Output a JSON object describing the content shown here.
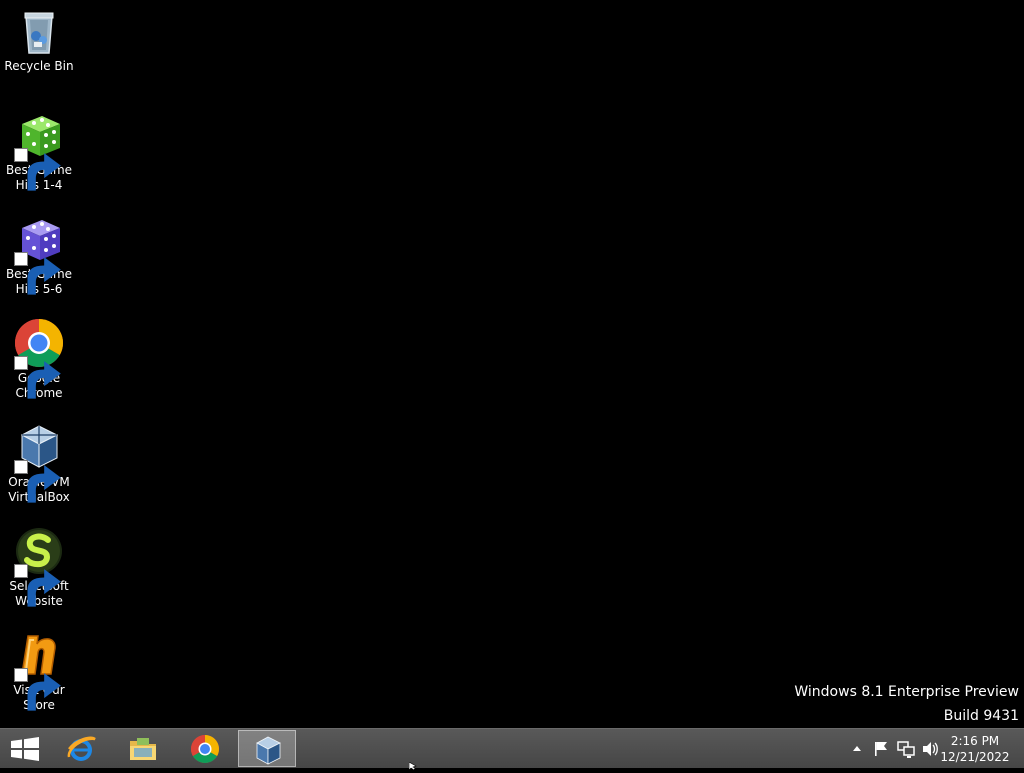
{
  "desktop": {
    "icons": [
      {
        "label": "Recycle Bin",
        "icon": "recycle-bin-icon"
      },
      {
        "label": "Best Game Hits 1-4",
        "line1": "Best Game",
        "line2": "Hits 1-4",
        "icon": "green-dice-icon"
      },
      {
        "label": "Best Game Hits 5-6",
        "line1": "Best Game",
        "line2": "Hits 5-6",
        "icon": "purple-dice-icon"
      },
      {
        "label": "Google Chrome",
        "line1": "Google",
        "line2": "Chrome",
        "icon": "chrome-icon"
      },
      {
        "label": "Oracle VM VirtualBox",
        "line1": "Oracle VM",
        "line2": "VirtualBox",
        "icon": "virtualbox-icon"
      },
      {
        "label": "Selectsoft Website",
        "line1": "Selectsoft",
        "line2": "Website",
        "icon": "selectsoft-icon"
      },
      {
        "label": "Visit Our Store",
        "line1": "Visit Our",
        "line2": "Store",
        "icon": "store-icon"
      }
    ]
  },
  "watermark": {
    "line1": "Windows 8.1 Enterprise Preview",
    "line2": "Build 9431"
  },
  "taskbar": {
    "pinned": [
      "internet-explorer-icon",
      "file-explorer-icon",
      "chrome-icon",
      "virtualbox-icon"
    ],
    "active_index": 3,
    "clock": {
      "time": "2:16 PM",
      "date": "12/21/2022"
    }
  },
  "colors": {
    "desktop_bg": "#000000",
    "taskbar_bg": "#4c4c4c"
  }
}
